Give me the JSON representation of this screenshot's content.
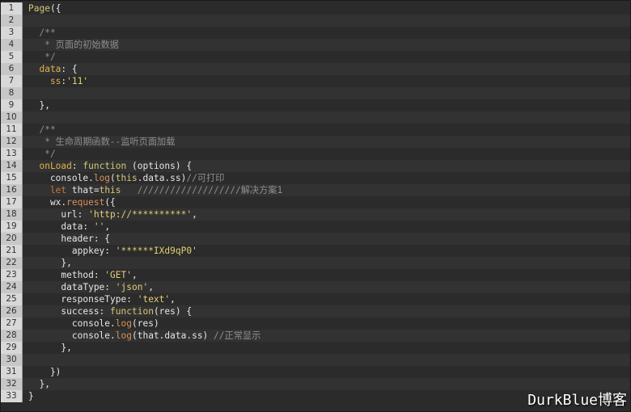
{
  "watermark": "DurkBlue博客",
  "lines": [
    {
      "num": "1",
      "tokens": [
        {
          "t": "Page",
          "c": "t-fn"
        },
        {
          "t": "({",
          "c": "t-plain"
        }
      ]
    },
    {
      "num": "2",
      "tokens": []
    },
    {
      "num": "3",
      "tokens": [
        {
          "t": "  /**",
          "c": "t-cmt"
        }
      ]
    },
    {
      "num": "4",
      "tokens": [
        {
          "t": "   * 页面的初始数据",
          "c": "t-cmt"
        }
      ]
    },
    {
      "num": "5",
      "tokens": [
        {
          "t": "   */",
          "c": "t-cmt"
        }
      ]
    },
    {
      "num": "6",
      "tokens": [
        {
          "t": "  data",
          "c": "t-key"
        },
        {
          "t": ": {",
          "c": "t-plain"
        }
      ]
    },
    {
      "num": "7",
      "tokens": [
        {
          "t": "    ss",
          "c": "t-key"
        },
        {
          "t": ":",
          "c": "t-plain"
        },
        {
          "t": "'11'",
          "c": "t-str"
        }
      ]
    },
    {
      "num": "8",
      "tokens": []
    },
    {
      "num": "9",
      "tokens": [
        {
          "t": "  },",
          "c": "t-plain"
        }
      ]
    },
    {
      "num": "10",
      "tokens": []
    },
    {
      "num": "11",
      "tokens": [
        {
          "t": "  /**",
          "c": "t-cmt"
        }
      ]
    },
    {
      "num": "12",
      "tokens": [
        {
          "t": "   * 生命周期函数--监听页面加载",
          "c": "t-cmt"
        }
      ]
    },
    {
      "num": "13",
      "tokens": [
        {
          "t": "   */",
          "c": "t-cmt"
        }
      ]
    },
    {
      "num": "14",
      "tokens": [
        {
          "t": "  onLoad",
          "c": "t-key"
        },
        {
          "t": ": ",
          "c": "t-plain"
        },
        {
          "t": "function",
          "c": "t-fn"
        },
        {
          "t": " (options) {",
          "c": "t-plain"
        }
      ]
    },
    {
      "num": "15",
      "tokens": [
        {
          "t": "    console.",
          "c": "t-plain"
        },
        {
          "t": "log",
          "c": "t-brown"
        },
        {
          "t": "(",
          "c": "t-plain"
        },
        {
          "t": "this",
          "c": "t-fn"
        },
        {
          "t": ".data.ss)",
          "c": "t-plain"
        },
        {
          "t": "//可打印",
          "c": "t-cmt"
        }
      ]
    },
    {
      "num": "16",
      "tokens": [
        {
          "t": "    let",
          "c": "t-kw"
        },
        {
          "t": " that=",
          "c": "t-plain"
        },
        {
          "t": "this",
          "c": "t-fn"
        },
        {
          "t": "   ///////////////////解决方案1",
          "c": "t-cmt"
        }
      ]
    },
    {
      "num": "17",
      "tokens": [
        {
          "t": "    wx.",
          "c": "t-plain"
        },
        {
          "t": "request",
          "c": "t-brown"
        },
        {
          "t": "({",
          "c": "t-plain"
        }
      ]
    },
    {
      "num": "18",
      "tokens": [
        {
          "t": "      url: ",
          "c": "t-plain"
        },
        {
          "t": "'http://**********'",
          "c": "t-str"
        },
        {
          "t": ",",
          "c": "t-plain"
        }
      ]
    },
    {
      "num": "19",
      "tokens": [
        {
          "t": "      data: ",
          "c": "t-plain"
        },
        {
          "t": "''",
          "c": "t-str"
        },
        {
          "t": ",",
          "c": "t-plain"
        }
      ]
    },
    {
      "num": "20",
      "tokens": [
        {
          "t": "      header: {",
          "c": "t-plain"
        }
      ]
    },
    {
      "num": "21",
      "tokens": [
        {
          "t": "        appkey: ",
          "c": "t-plain"
        },
        {
          "t": "'******IXd9qP0'",
          "c": "t-str"
        }
      ]
    },
    {
      "num": "22",
      "tokens": [
        {
          "t": "      },",
          "c": "t-plain"
        }
      ]
    },
    {
      "num": "23",
      "tokens": [
        {
          "t": "      method: ",
          "c": "t-plain"
        },
        {
          "t": "'GET'",
          "c": "t-str"
        },
        {
          "t": ",",
          "c": "t-plain"
        }
      ]
    },
    {
      "num": "24",
      "tokens": [
        {
          "t": "      dataType: ",
          "c": "t-plain"
        },
        {
          "t": "'json'",
          "c": "t-str"
        },
        {
          "t": ",",
          "c": "t-plain"
        }
      ]
    },
    {
      "num": "25",
      "tokens": [
        {
          "t": "      responseType: ",
          "c": "t-plain"
        },
        {
          "t": "'text'",
          "c": "t-str"
        },
        {
          "t": ",",
          "c": "t-plain"
        }
      ]
    },
    {
      "num": "26",
      "tokens": [
        {
          "t": "      success: ",
          "c": "t-plain"
        },
        {
          "t": "function",
          "c": "t-fn"
        },
        {
          "t": "(res) {",
          "c": "t-plain"
        }
      ]
    },
    {
      "num": "27",
      "tokens": [
        {
          "t": "        console.",
          "c": "t-plain"
        },
        {
          "t": "log",
          "c": "t-brown"
        },
        {
          "t": "(res)",
          "c": "t-plain"
        }
      ]
    },
    {
      "num": "28",
      "tokens": [
        {
          "t": "        console.",
          "c": "t-plain"
        },
        {
          "t": "log",
          "c": "t-brown"
        },
        {
          "t": "(that.data.ss) ",
          "c": "t-plain"
        },
        {
          "t": "//正常显示",
          "c": "t-cmt"
        }
      ]
    },
    {
      "num": "29",
      "tokens": [
        {
          "t": "      },",
          "c": "t-plain"
        }
      ]
    },
    {
      "num": "30",
      "tokens": []
    },
    {
      "num": "31",
      "tokens": [
        {
          "t": "    })",
          "c": "t-plain"
        }
      ]
    },
    {
      "num": "32",
      "tokens": [
        {
          "t": "  },",
          "c": "t-plain"
        }
      ]
    },
    {
      "num": "33",
      "tokens": [
        {
          "t": "}",
          "c": "t-plain"
        }
      ]
    }
  ]
}
